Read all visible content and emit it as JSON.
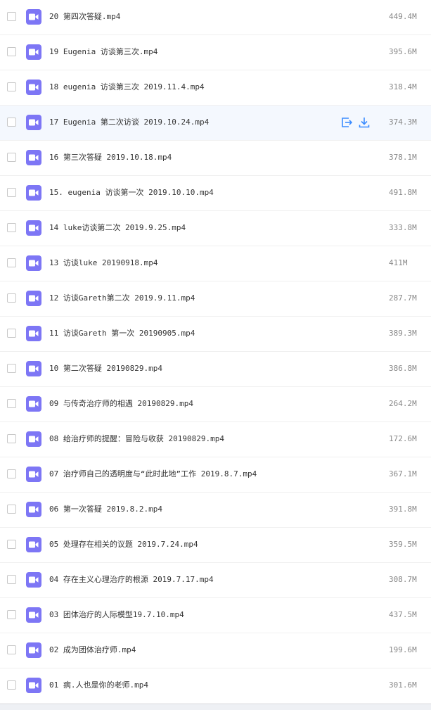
{
  "colors": {
    "icon_bg": "#7d76f5",
    "hover_row_bg": "#f4f8fe",
    "action_icon": "#3b8cff",
    "text": "#333333",
    "size_text": "#888888"
  },
  "files": [
    {
      "name": "20 第四次答疑.mp4",
      "size": "449.4M",
      "icon": "video-file-icon"
    },
    {
      "name": "19 Eugenia 访谈第三次.mp4",
      "size": "395.6M",
      "icon": "video-file-icon"
    },
    {
      "name": "18 eugenia 访谈第三次 2019.11.4.mp4",
      "size": "318.4M",
      "icon": "video-file-icon"
    },
    {
      "name": "17 Eugenia 第二次访谈 2019.10.24.mp4",
      "size": "374.3M",
      "icon": "video-file-icon",
      "hovered": true,
      "actions": [
        "share-icon",
        "download-icon"
      ]
    },
    {
      "name": "16 第三次答疑 2019.10.18.mp4",
      "size": "378.1M",
      "icon": "video-file-icon"
    },
    {
      "name": "15. eugenia 访谈第一次 2019.10.10.mp4",
      "size": "491.8M",
      "icon": "video-file-icon"
    },
    {
      "name": "14 luke访谈第二次 2019.9.25.mp4",
      "size": "333.8M",
      "icon": "video-file-icon"
    },
    {
      "name": "13 访谈luke 20190918.mp4",
      "size": "411M",
      "icon": "video-file-icon"
    },
    {
      "name": "12 访谈Gareth第二次 2019.9.11.mp4",
      "size": "287.7M",
      "icon": "video-file-icon"
    },
    {
      "name": "11 访谈Gareth 第一次 20190905.mp4",
      "size": "389.3M",
      "icon": "video-file-icon"
    },
    {
      "name": "10 第二次答疑 20190829.mp4",
      "size": "386.8M",
      "icon": "video-file-icon"
    },
    {
      "name": "09 与传奇治疗师的相遇 20190829.mp4",
      "size": "264.2M",
      "icon": "video-file-icon"
    },
    {
      "name": "08 给治疗师的提醒：冒险与收获 20190829.mp4",
      "size": "172.6M",
      "icon": "video-file-icon"
    },
    {
      "name": "07 治疗师自己的透明度与“此时此地”工作 2019.8.7.mp4",
      "size": "367.1M",
      "icon": "video-file-icon"
    },
    {
      "name": "06 第一次答疑 2019.8.2.mp4",
      "size": "391.8M",
      "icon": "video-file-icon"
    },
    {
      "name": "05 处理存在相关的议题 2019.7.24.mp4",
      "size": "359.5M",
      "icon": "video-file-icon"
    },
    {
      "name": "04 存在主义心理治疗的根源 2019.7.17.mp4",
      "size": "308.7M",
      "icon": "video-file-icon"
    },
    {
      "name": "03 团体治疗的人际模型19.7.10.mp4",
      "size": "437.5M",
      "icon": "video-file-icon"
    },
    {
      "name": "02 成为团体治疗师.mp4",
      "size": "199.6M",
      "icon": "video-file-icon"
    },
    {
      "name": "01 病.人也是你的老师.mp4",
      "size": "301.6M",
      "icon": "video-file-icon"
    }
  ]
}
